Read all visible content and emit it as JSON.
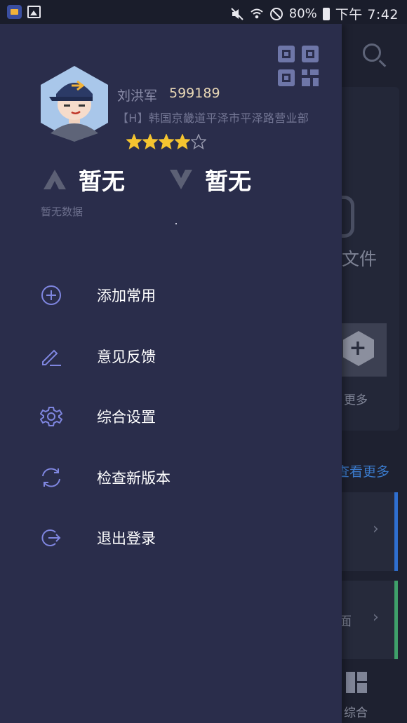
{
  "status_bar": {
    "battery": "80%",
    "time": "下午 7:42"
  },
  "user": {
    "name": "刘洪军",
    "id": "599189",
    "department": "【H】韩国京畿道平泽市平泽路营业部",
    "rating": 4,
    "rating_max": 5
  },
  "stats": [
    {
      "icon": "up-chevron-icon",
      "value": "暂无"
    },
    {
      "icon": "down-chevron-icon",
      "value": "暂无"
    }
  ],
  "stats_note": "暂无数据",
  "menu": {
    "items": [
      {
        "icon": "plus-circle-icon",
        "label": "添加常用"
      },
      {
        "icon": "pencil-icon",
        "label": "意见反馈"
      },
      {
        "icon": "gear-icon",
        "label": "综合设置"
      },
      {
        "icon": "refresh-icon",
        "label": "检查新版本"
      },
      {
        "icon": "logout-icon",
        "label": "退出登录"
      }
    ]
  },
  "background_app": {
    "partial_label": "文件",
    "more_label": "更多",
    "see_more": "查看更多",
    "row_text": "面",
    "bottom_nav_label": "综合"
  },
  "colors": {
    "drawer_bg": "#2a2d4b",
    "accent_icon": "#7f86e0",
    "user_id": "#e9d8b6",
    "star": "#f4c430"
  }
}
